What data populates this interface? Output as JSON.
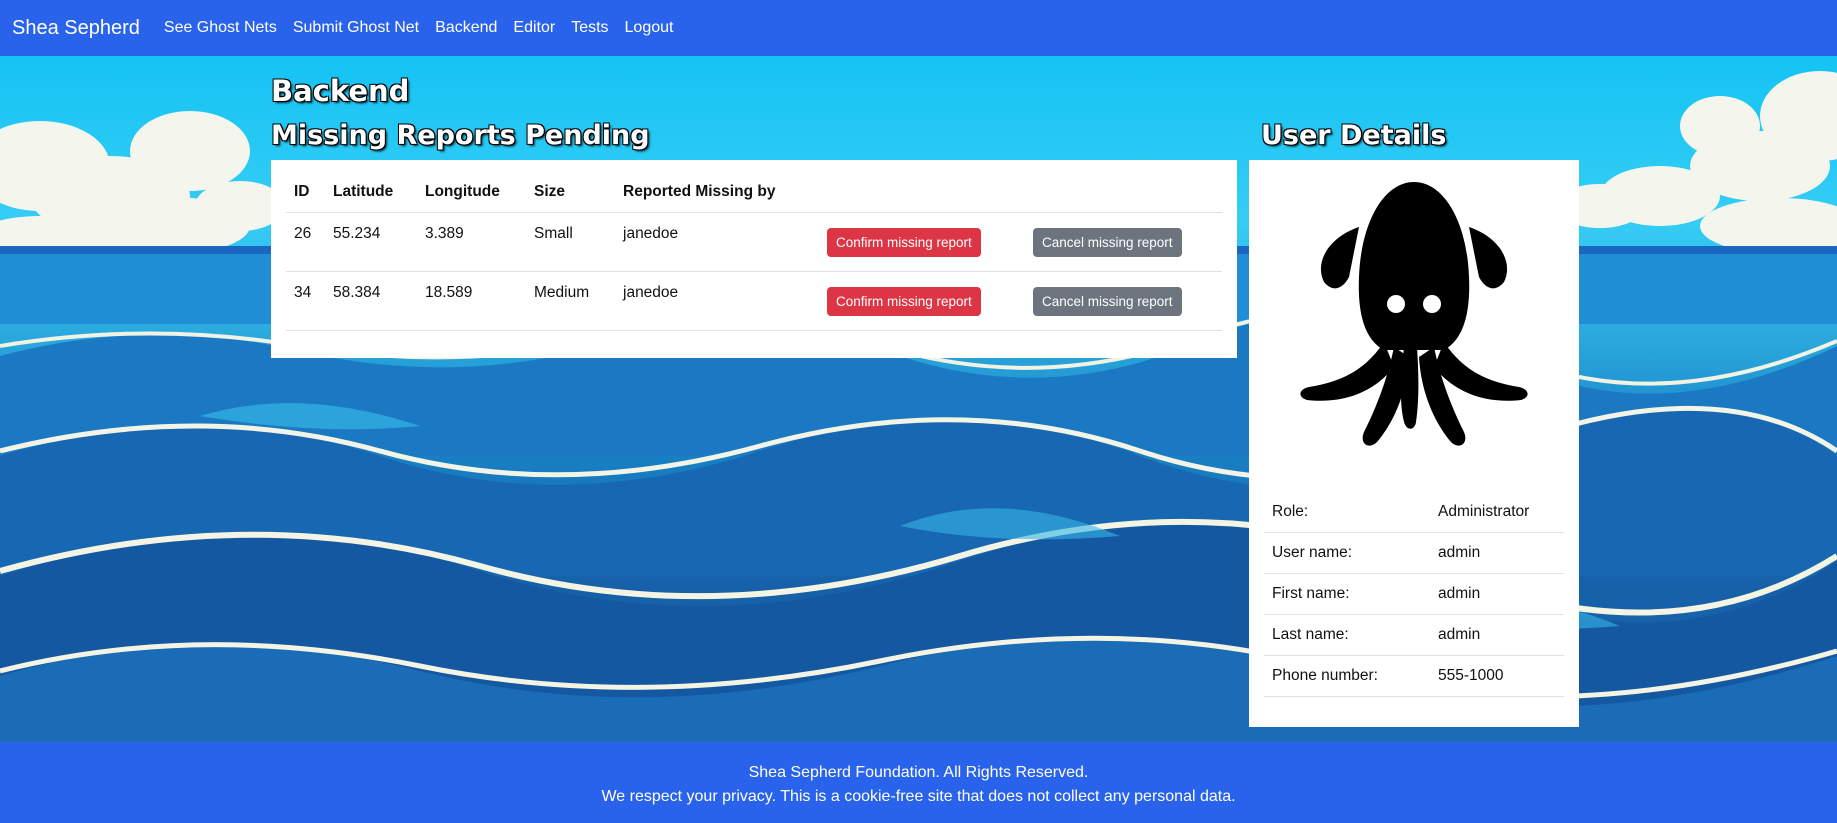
{
  "nav": {
    "brand": "Shea Sepherd",
    "links": [
      "See Ghost Nets",
      "Submit Ghost Net",
      "Backend",
      "Editor",
      "Tests",
      "Logout"
    ]
  },
  "page": {
    "title": "Backend",
    "pending_heading": "Missing Reports Pending",
    "user_heading": "User Details"
  },
  "table": {
    "headers": [
      "ID",
      "Latitude",
      "Longitude",
      "Size",
      "Reported Missing by"
    ],
    "rows": [
      {
        "id": "26",
        "latitude": "55.234",
        "longitude": "3.389",
        "size": "Small",
        "reported_by": "janedoe",
        "confirm_label": "Confirm missing report",
        "cancel_label": "Cancel missing report"
      },
      {
        "id": "34",
        "latitude": "58.384",
        "longitude": "18.589",
        "size": "Medium",
        "reported_by": "janedoe",
        "confirm_label": "Confirm missing report",
        "cancel_label": "Cancel missing report"
      }
    ]
  },
  "user": {
    "avatar_icon": "squid-icon",
    "details": [
      {
        "label": "Role:",
        "value": "Administrator"
      },
      {
        "label": "User name:",
        "value": "admin"
      },
      {
        "label": "First name:",
        "value": "admin"
      },
      {
        "label": "Last name:",
        "value": "admin"
      },
      {
        "label": "Phone number:",
        "value": "555-1000"
      }
    ]
  },
  "footer": {
    "line1": "Shea Sepherd Foundation. All Rights Reserved.",
    "line2": "We respect your privacy. This is a cookie-free site that does not collect any personal data."
  },
  "colors": {
    "navbar": "#2a63eb",
    "danger": "#dc3545",
    "secondary": "#6c757d"
  }
}
